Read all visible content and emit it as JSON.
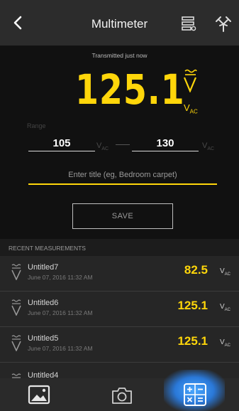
{
  "header": {
    "title": "Multimeter",
    "icons": [
      "back-icon",
      "log-list-icon",
      "wiring-icon"
    ]
  },
  "meter": {
    "status": "Transmitted just now",
    "reading": "125.1",
    "unit": "V",
    "unit_sub": "AC",
    "mode_icon": "voltage-ac-icon"
  },
  "range": {
    "label": "Range",
    "low": "105",
    "high": "130",
    "unit": "V",
    "unit_sub": "AC"
  },
  "title_input": {
    "placeholder": "Enter title (eg, Bedroom carpet)",
    "value": ""
  },
  "save_label": "SAVE",
  "recent": {
    "header": "RECENT MEASUREMENTS",
    "items": [
      {
        "name": "Untitled7",
        "date": "June 07, 2016 11:32 AM",
        "value": "82.5",
        "unit": "V",
        "unit_sub": "AC"
      },
      {
        "name": "Untitled6",
        "date": "June 07, 2016 11:32 AM",
        "value": "125.1",
        "unit": "V",
        "unit_sub": "AC"
      },
      {
        "name": "Untitled5",
        "date": "June 07, 2016 11:32 AM",
        "value": "125.1",
        "unit": "V",
        "unit_sub": "AC"
      },
      {
        "name": "Untitled4",
        "date": "",
        "value": "",
        "unit": "",
        "unit_sub": ""
      }
    ]
  },
  "tabs": [
    "gallery-icon",
    "camera-icon",
    "calculator-icon"
  ],
  "colors": {
    "accent": "#ffd60a",
    "active_tab_glow": "#4aa8ff"
  }
}
